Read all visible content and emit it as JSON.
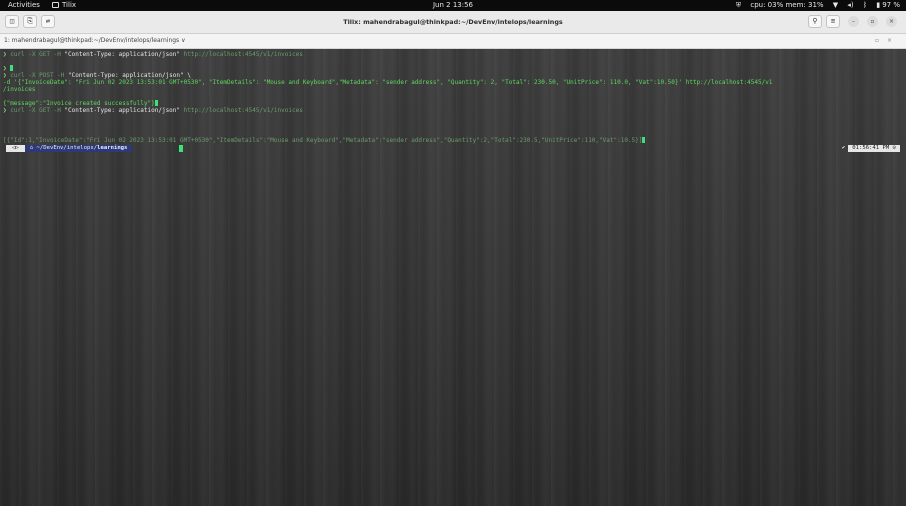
{
  "topbar": {
    "activities": "Activities",
    "app_name": "Tilix",
    "clock": "Jun 2  13:56",
    "sys_icon": "shield-icon",
    "cpu_mem": "cpu: 03% mem: 31%",
    "battery": "97 %"
  },
  "window": {
    "title": "Tilix: mahendrabagul@thinkpad:~/DevEnv/intelops/learnings",
    "session_label": "1: mahendrabagul@thinkpad:~/DevEnv/intelops/learnings ∨"
  },
  "terminal": {
    "lines": [
      {
        "prefix": "❯ ",
        "cmd": "curl -X GET -H ",
        "arg": "\"Content-Type: application/json\"",
        "url": " http://localhost:4545/v1/invoices"
      },
      {
        "blank": ""
      },
      {
        "cursor_prompt": "❯ "
      },
      {
        "prefix": "❯ ",
        "cmd": "curl -X POST -H ",
        "arg": "\"Content-Type: application/json\"",
        "tail": " \\"
      },
      {
        "data_line": "-d '{\"InvoiceDate\": \"Fri Jun 02 2023 13:53:01 GMT+0530\", \"ItemDetails\": \"Mouse and Keyboard\",\"Metadata\": \"sender address\", \"Quantity\": 2, \"Total\": 230.50, \"UnitPrice\": 110.0, \"Vat\":10.50}' http://localhost:4545/v1"
      },
      {
        "data_line": "/invoices"
      },
      {
        "blank": ""
      },
      {
        "response": "{\"message\":\"Invoice created successfully\"}"
      },
      {
        "prefix": "❯ ",
        "cmd": "curl -X GET -H ",
        "arg": "\"Content-Type: application/json\"",
        "url": " http://localhost:4545/v1/invoices"
      },
      {
        "blank": ""
      },
      {
        "response": "[{\"Id\":1,\"InvoiceDate\":\"Fri Jun 02 2023 13:53:01 GMT+0530\",\"ItemDetails\":\"Mouse and Keyboard\",\"Metadata\":\"sender address\",\"Quantity\":2,\"Total\":230.5,\"UnitPrice\":110,\"Vat\":10.5}]"
      }
    ],
    "prompt": {
      "os_icon": "ubuntu-icon",
      "path_prefix": "⌂ ~/DevEnv/intelops/",
      "path_dir": "learnings",
      "status": "✔",
      "time": "01:56:41 PM ⊙"
    }
  }
}
